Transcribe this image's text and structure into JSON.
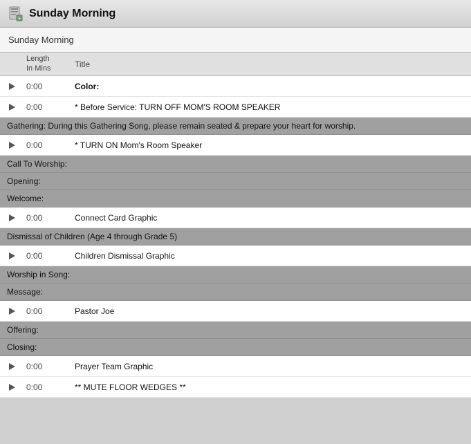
{
  "titleBar": {
    "title": "Sunday Morning",
    "iconAlt": "document-icon"
  },
  "subtitleBar": {
    "label": "Sunday Morning"
  },
  "tableHeader": {
    "lengthLabel": "Length",
    "lengthSubLabel": "In Mins",
    "titleLabel": "Title"
  },
  "rows": [
    {
      "type": "item",
      "time": "0:00",
      "title": "Color:",
      "bold": true
    },
    {
      "type": "item",
      "time": "0:00",
      "title": "* Before Service: TURN OFF MOM'S ROOM SPEAKER",
      "bold": false
    },
    {
      "type": "section",
      "title": "Gathering: During this Gathering Song, please remain seated & prepare your heart for worship."
    },
    {
      "type": "item",
      "time": "0:00",
      "title": "* TURN ON Mom's Room Speaker",
      "bold": false
    },
    {
      "type": "section",
      "title": "Call To Worship:"
    },
    {
      "type": "section",
      "title": "Opening:"
    },
    {
      "type": "section",
      "title": "Welcome:"
    },
    {
      "type": "item",
      "time": "0:00",
      "title": "Connect Card Graphic",
      "bold": false
    },
    {
      "type": "section",
      "title": "Dismissal of Children (Age 4 through Grade 5)"
    },
    {
      "type": "item",
      "time": "0:00",
      "title": "Children Dismissal Graphic",
      "bold": false
    },
    {
      "type": "section",
      "title": "Worship in Song:"
    },
    {
      "type": "section",
      "title": "Message:"
    },
    {
      "type": "item",
      "time": "0:00",
      "title": "Pastor Joe",
      "bold": false
    },
    {
      "type": "section",
      "title": "Offering:"
    },
    {
      "type": "section",
      "title": "Closing:"
    },
    {
      "type": "item",
      "time": "0:00",
      "title": "Prayer Team Graphic",
      "bold": false
    },
    {
      "type": "item",
      "time": "0:00",
      "title": "** MUTE FLOOR WEDGES **",
      "bold": false
    }
  ]
}
